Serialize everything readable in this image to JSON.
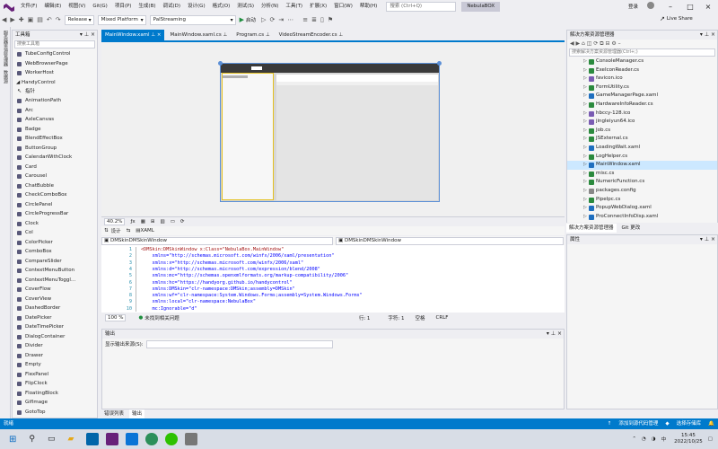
{
  "menubar": {
    "items": [
      "文件(F)",
      "编辑(E)",
      "视图(V)",
      "Git(G)",
      "项目(P)",
      "生成(B)",
      "调试(D)",
      "设计(G)",
      "格式(O)",
      "测试(S)",
      "分析(N)",
      "工具(T)",
      "扩展(X)",
      "窗口(W)",
      "帮助(H)"
    ],
    "search_placeholder": "搜索 (Ctrl+Q)",
    "solution_name": "NebulaBOX",
    "signin": "登录",
    "liveshare": "Live Share"
  },
  "toolbar": {
    "config": "Release",
    "platform": "Mixed Platform",
    "startup": "PalStreaming",
    "run_label": "启动"
  },
  "leftstrip": {
    "items": [
      "服务器资源管理器",
      "数据源"
    ]
  },
  "toolbox": {
    "title": "工具箱",
    "search_placeholder": "搜索工具箱",
    "pre_items": [
      "TubeConfigControl",
      "WebBrowserPage",
      "WorkerHost"
    ],
    "category": "HandyControl",
    "items": [
      "指针",
      "AnimationPath",
      "Arc",
      "AxleCanvas",
      "Badge",
      "BlendEffectBox",
      "ButtonGroup",
      "CalendarWithClock",
      "Card",
      "Carousel",
      "ChatBubble",
      "CheckComboBox",
      "CirclePanel",
      "CircleProgressBar",
      "Clock",
      "Col",
      "ColorPicker",
      "ComboBox",
      "CompareSlider",
      "ContextMenuButton",
      "ContextMenuToggl...",
      "CoverFlow",
      "CoverView",
      "DashedBorder",
      "DatePicker",
      "DateTimePicker",
      "DialogContainer",
      "Divider",
      "Drawer",
      "Empty",
      "FlexPanel",
      "FlipClock",
      "FloatingBlock",
      "GifImage",
      "GotoTop"
    ]
  },
  "doctabs": [
    "MainWindow.xaml",
    "MainWindow.xaml.cs",
    "Program.cs",
    "VideoStreamEncoder.cs"
  ],
  "designer": {
    "zoom": "40.2%",
    "design_tab": "设计",
    "xaml_tab": "XAML"
  },
  "code_combos": {
    "left": "DMSkinDMSkinWindow",
    "right": "DMSkinDMSkinWindow"
  },
  "code_lines": [
    {
      "n": "1",
      "t": "<DMSkin:DMSkinWindow x:Class=\"NebulaBox.MainWindow\""
    },
    {
      "n": "2",
      "t": "    xmlns=\"http://schemas.microsoft.com/winfx/2006/xaml/presentation\""
    },
    {
      "n": "3",
      "t": "    xmlns:x=\"http://schemas.microsoft.com/winfx/2006/xaml\""
    },
    {
      "n": "4",
      "t": "    xmlns:d=\"http://schemas.microsoft.com/expression/blend/2008\""
    },
    {
      "n": "5",
      "t": "    xmlns:mc=\"http://schemas.openxmlformats.org/markup-compatibility/2006\""
    },
    {
      "n": "6",
      "t": "    xmlns:hc=\"https://handyorg.github.io/handycontrol\""
    },
    {
      "n": "7",
      "t": "    xmlns:DMSkin=\"clr-namespace:DMSkin;assembly=DMSkin\""
    },
    {
      "n": "8",
      "t": "    xmlns:wf=\"clr-namespace:System.Windows.Forms;assembly=System.Windows.Forms\""
    },
    {
      "n": "9",
      "t": "    xmlns:local=\"clr-namespace:NebulaBox\""
    },
    {
      "n": "10",
      "t": "    mc:Ignorable=\"d\""
    }
  ],
  "code_status": {
    "zoom": "100 %",
    "issues": "未找到相关问题",
    "line": "行: 1",
    "char": "字符: 1",
    "spaces": "空格",
    "eol": "CRLF"
  },
  "output": {
    "title": "输出",
    "source_label": "显示输出来源(S):"
  },
  "bottom_tabs": [
    "错误列表",
    "输出"
  ],
  "solexp": {
    "title": "解决方案资源管理器",
    "search_placeholder": "搜索解决方案资源管理器(Ctrl+;)",
    "files": [
      {
        "name": "ConsoleManager.cs",
        "type": "cs"
      },
      {
        "name": "ExeIconReader.cs",
        "type": "cs"
      },
      {
        "name": "favicon.ico",
        "type": "ico"
      },
      {
        "name": "FormUtility.cs",
        "type": "cs"
      },
      {
        "name": "GameManagerPage.xaml",
        "type": "xaml"
      },
      {
        "name": "HardwareInfoReader.cs",
        "type": "cs"
      },
      {
        "name": "hbccy-128.ico",
        "type": "ico"
      },
      {
        "name": "jingleiyun64.ico",
        "type": "ico"
      },
      {
        "name": "Job.cs",
        "type": "cs"
      },
      {
        "name": "JSExternal.cs",
        "type": "cs"
      },
      {
        "name": "LoadingWait.xaml",
        "type": "xaml"
      },
      {
        "name": "LogHelper.cs",
        "type": "cs"
      },
      {
        "name": "MainWindow.xaml",
        "type": "xaml"
      },
      {
        "name": "misc.cs",
        "type": "cs"
      },
      {
        "name": "NumericFunction.cs",
        "type": "cs"
      },
      {
        "name": "packages.config",
        "type": "cfg"
      },
      {
        "name": "PipeIpc.cs",
        "type": "cs"
      },
      {
        "name": "PopupWebDialog.xaml",
        "type": "xaml"
      },
      {
        "name": "ProConnectInfoDisp.xaml",
        "type": "xaml"
      }
    ],
    "selected": "MainWindow.xaml",
    "tabs": [
      "解决方案资源管理器",
      "Git 更改"
    ]
  },
  "props": {
    "title": "属性"
  },
  "statusbar": {
    "left": "就绪",
    "add_source": "添加到源代码管理",
    "select_repo": "选择存储库"
  },
  "taskbar": {
    "time": "15:45",
    "date": "2022/10/25",
    "lang": "中",
    "weather": "25°C"
  },
  "colors": {
    "accent": "#007acc",
    "selected": "#cce8ff"
  }
}
